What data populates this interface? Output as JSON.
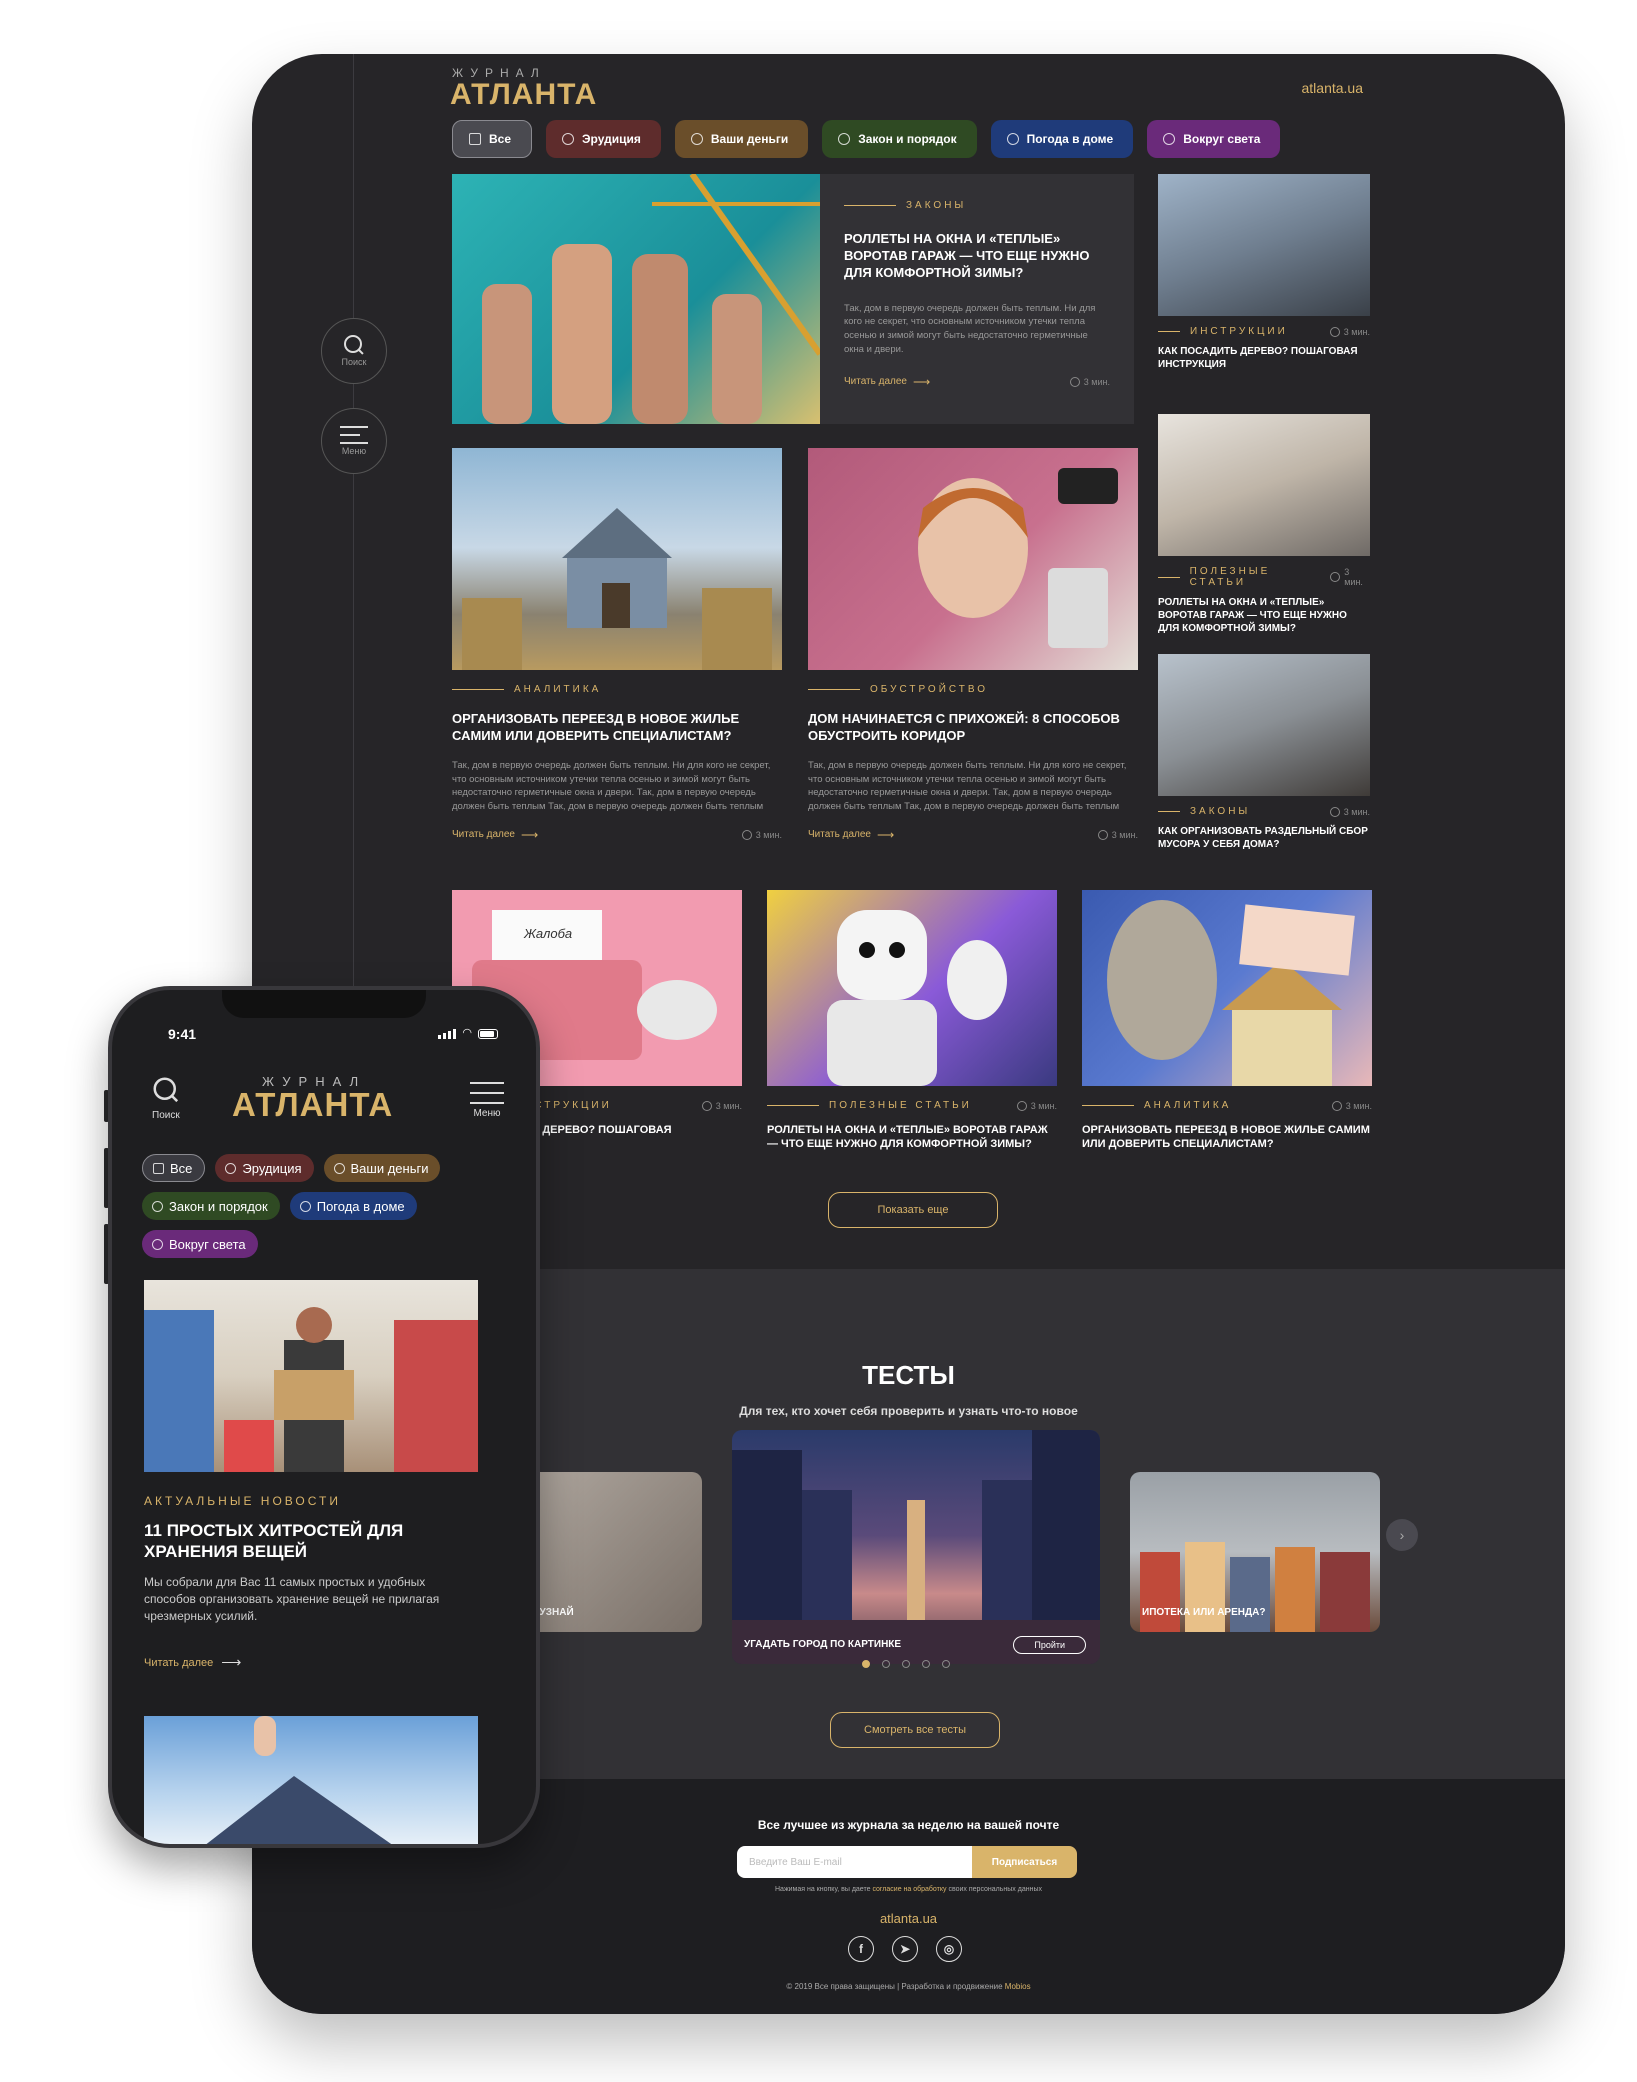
{
  "site": {
    "logo_small": "ЖУРНАЛ",
    "logo": "АТЛАНТА",
    "url": "atlanta.ua"
  },
  "rail": {
    "search_label": "Поиск",
    "menu_label": "Меню"
  },
  "tabs": [
    {
      "label": "Все"
    },
    {
      "label": "Эрудиция"
    },
    {
      "label": "Ваши деньги"
    },
    {
      "label": "Закон и порядок"
    },
    {
      "label": "Погода в доме"
    },
    {
      "label": "Вокруг света"
    }
  ],
  "featured": {
    "category": "ЗАКОНЫ",
    "title": "РОЛЛЕТЫ НА ОКНА И «ТЕПЛЫЕ» ВОРОТАВ ГАРАЖ — ЧТО ЕЩЕ НУЖНО ДЛЯ КОМФОРТНОЙ ЗИМЫ?",
    "desc": "Так, дом в первую очередь должен быть теплым. Ни для кого не секрет, что основным источником утечки тепла осенью и зимой могут быть недостаточно герметичные окна и двери.",
    "more": "Читать далее",
    "time": "3 мин."
  },
  "side_cards": [
    {
      "category": "ИНСТРУКЦИИ",
      "time": "3 мин.",
      "title": "КАК ПОСАДИТЬ ДЕРЕВО? ПОШАГОВАЯ ИНСТРУКЦИЯ"
    },
    {
      "category": "ПОЛЕЗНЫЕ СТАТЬИ",
      "time": "3 мин.",
      "title": "РОЛЛЕТЫ НА ОКНА И «ТЕПЛЫЕ» ВОРОТАВ ГАРАЖ — ЧТО ЕЩЕ НУЖНО ДЛЯ КОМФОРТНОЙ ЗИМЫ?"
    },
    {
      "category": "ЗАКОНЫ",
      "time": "3 мин.",
      "title": "КАК ОРГАНИЗОВАТЬ РАЗДЕЛЬНЫЙ СБОР МУСОРА У СЕБЯ ДОМА?"
    }
  ],
  "mid_cards": [
    {
      "category": "АНАЛИТИКА",
      "title": "ОРГАНИЗОВАТЬ ПЕРЕЕЗД В НОВОЕ ЖИЛЬЕ САМИМ ИЛИ ДОВЕРИТЬ СПЕЦИАЛИСТАМ?",
      "desc": "Так, дом в первую очередь должен быть теплым. Ни для кого не секрет, что основным источником утечки тепла осенью и зимой могут быть недостаточно герметичные окна и двери. Так, дом в первую очередь должен быть теплым Так, дом в первую очередь должен быть теплым",
      "more": "Читать далее",
      "time": "3 мин."
    },
    {
      "category": "ОБУСТРОЙСТВО",
      "title": "ДОМ НАЧИНАЕТСЯ С ПРИХОЖЕЙ: 8 СПОСОБОВ ОБУСТРОИТЬ КОРИДОР",
      "desc": "Так, дом в первую очередь должен быть теплым. Ни для кого не секрет, что основным источником утечки тепла осенью и зимой могут быть недостаточно герметичные окна и двери. Так, дом в первую очередь должен быть теплым Так, дом в первую очередь должен быть теплым",
      "more": "Читать далее",
      "time": "3 мин."
    }
  ],
  "bottom_cards": [
    {
      "category": "ИНСТРУКЦИИ",
      "time": "3 мин.",
      "title": "КАК ПОСАДИТЬ ДЕРЕВО? ПОШАГОВАЯ ИНСТРУКЦИЯ",
      "img_text": "Жалоба"
    },
    {
      "category": "ПОЛЕЗНЫЕ СТАТЬИ",
      "time": "3 мин.",
      "title": "РОЛЛЕТЫ НА ОКНА И «ТЕПЛЫЕ» ВОРОТАВ ГАРАЖ — ЧТО ЕЩЕ НУЖНО ДЛЯ КОМФОРТНОЙ ЗИМЫ?"
    },
    {
      "category": "АНАЛИТИКА",
      "time": "3 мин.",
      "title": "ОРГАНИЗОВАТЬ ПЕРЕЕЗД В НОВОЕ ЖИЛЬЕ САМИМ ИЛИ ДОВЕРИТЬ СПЕЦИАЛИСТАМ?"
    }
  ],
  "show_more": "Показать еще",
  "tests": {
    "title": "ТЕСТЫ",
    "subtitle": "Для тех, кто хочет себя проверить и узнать что-то новое",
    "cards": [
      {
        "label": "И РЕМОНТЕ: УЗНАЙ"
      },
      {
        "label": "УГАДАТЬ ГОРОД ПО КАРТИНКЕ",
        "button": "Пройти"
      },
      {
        "label": "ИПОТЕКА ИЛИ АРЕНДА?"
      }
    ],
    "all_button": "Смотреть все тесты"
  },
  "footer": {
    "newsletter_title": "Все лучшее из журнала за неделю на вашей почте",
    "email_placeholder": "Введите Ваш E-mail",
    "subscribe": "Подписаться",
    "note_prefix": "Нажимая на кнопку, вы даете",
    "note_link": "согласие на обработку",
    "note_suffix": "своих персональных данных",
    "url": "atlanta.ua",
    "copyright": "© 2019 Все права защищены | Разработка и продвижение",
    "developer": "Mobios"
  },
  "phone": {
    "time": "9:41",
    "search_label": "Поиск",
    "menu_label": "Меню",
    "logo_small": "ЖУРНАЛ",
    "logo": "АТЛАНТА",
    "tabs": [
      "Все",
      "Эрудиция",
      "Ваши деньги",
      "Закон и порядок",
      "Погода в доме",
      "Вокруг света"
    ],
    "category": "АКТУАЛЬНЫЕ НОВОСТИ",
    "title": "11 ПРОСТЫХ ХИТРОСТЕЙ ДЛЯ ХРАНЕНИЯ ВЕЩЕЙ",
    "desc": "Мы собрали для Вас 11 самых простых и удобных способов организовать хранение вещей не прилагая чрезмерных усилий.",
    "more": "Читать далее"
  },
  "colors": {
    "accent": "#d9b46a",
    "bg": "#262528",
    "erudition": "#5e2c2c",
    "money": "#6a4e2a",
    "law": "#2f4a23",
    "weather": "#1f3b7a",
    "world": "#6a2a7a"
  }
}
